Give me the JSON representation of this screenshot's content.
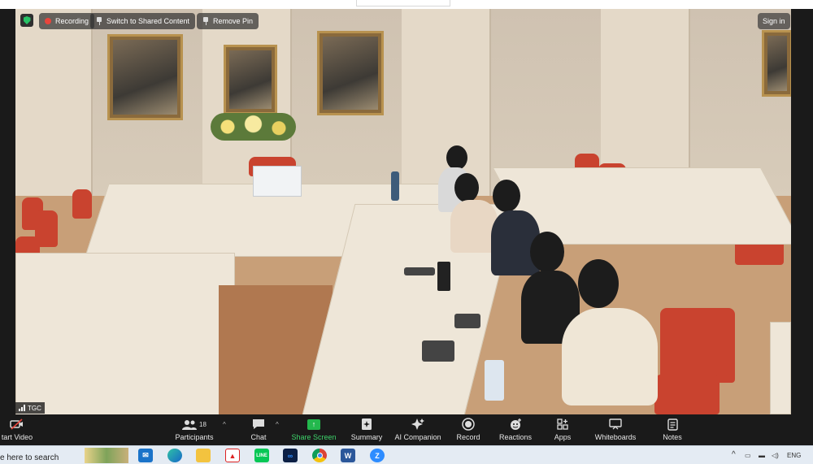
{
  "overlay": {
    "recording_label": "Recording",
    "switch_label": "Switch to Shared Content",
    "remove_pin_label": "Remove Pin",
    "sign_in_label": "Sign in",
    "participant_name": "TGC"
  },
  "toolbar": {
    "start_video_label": "tart Video",
    "participants_label": "Participants",
    "participants_count": "18",
    "chat_label": "Chat",
    "share_screen_label": "Share Screen",
    "summary_label": "Summary",
    "ai_companion_label": "AI Companion",
    "record_label": "Record",
    "reactions_label": "Reactions",
    "apps_label": "Apps",
    "whiteboards_label": "Whiteboards",
    "notes_label": "Notes"
  },
  "taskbar": {
    "search_placeholder": "e here to search",
    "tray_caret": "^",
    "language": "ENG",
    "apps": [
      "mail-icon",
      "edge-icon",
      "file-explorer-icon",
      "pdf-icon",
      "line-icon",
      "zoom-workplace-icon",
      "chrome-icon",
      "word-icon",
      "zoom-icon"
    ]
  },
  "colors": {
    "toolbar_bg": "#1a1a1a",
    "share_green": "#23b84d",
    "recording_red": "#e8453c",
    "taskbar_bg": "#e4ebf3"
  }
}
